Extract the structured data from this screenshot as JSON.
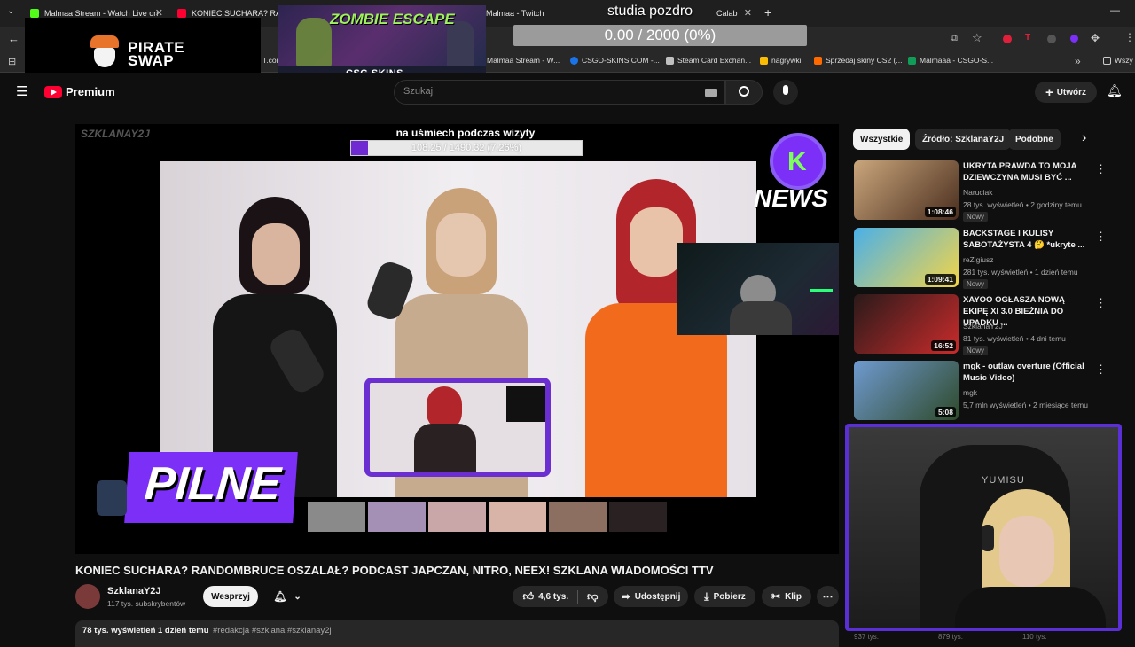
{
  "browser": {
    "tabs": [
      {
        "title": "Malmaa Stream - Watch Live on",
        "color": "#53fc18"
      },
      {
        "title": "KONIEC SUCHARA? RAND",
        "color": "#ff0033"
      },
      {
        "title": "Malmaa - Twitch",
        "color": "#9146ff"
      },
      {
        "title": "Calab",
        "color": "#888888"
      }
    ],
    "new_tab": "+",
    "minimize": "—",
    "bookmarks": [
      {
        "label": "T.com",
        "color": "#4285f4"
      },
      {
        "label": "Malmaa Stream - W...",
        "color": "#53fc18"
      },
      {
        "label": "CSGO-SKINS.COM -...",
        "color": "#1a73e8"
      },
      {
        "label": "Steam Card Exchan...",
        "color": "#c0c0c0"
      },
      {
        "label": "nagrywki",
        "color": "#fbbc04"
      },
      {
        "label": "Sprzedaj skiny CS2 (...",
        "color": "#ff6a00"
      },
      {
        "label": "Malmaaa - CSGO-S...",
        "color": "#0f9d58"
      },
      {
        "label": "Wszy",
        "color": "#888888"
      }
    ],
    "more_bookmarks": "»"
  },
  "overlays": {
    "pirate_logo_line1": "PIRATE",
    "pirate_logo_line2": "SWAP",
    "zombie_title": "ZOMBIE ESCAPE",
    "csgo_skins": "CSG SKINS",
    "studia_text": "studia pozdro",
    "goal_text": "0.00 / 2000 (0%)",
    "video_goal_title": "na uśmiech podczas wizyty",
    "video_goal_text": "108.25 / 1490.32 (7.26%)",
    "video_goal_progress": 0.0726,
    "video_watermark": "SZKLANAY2J",
    "news_label": "NEWS",
    "pilne_label": "PILNE",
    "chair_brand": "YUMISU"
  },
  "youtube": {
    "logo_text": "Premium",
    "search_placeholder": "Szukaj",
    "create_label": "Utwórz",
    "chips": [
      "Wszystkie",
      "Źródło: SzklanaY2J",
      "Podobne"
    ],
    "video_title": "KONIEC SUCHARA? RANDOMBRUCE OSZALAŁ? PODCAST JAPCZAN, NITRO, NEEX! SZKLANA WIADOMOŚCI TTV",
    "channel_name": "SzklanaY2J",
    "subscribers": "117 tys. subskrybentów",
    "support_label": "Wesprzyj",
    "likes": "4,6 tys.",
    "share_label": "Udostępnij",
    "download_label": "Pobierz",
    "clip_label": "Klip",
    "description": {
      "views": "78 tys. wyświetleń",
      "age": "1 dzień temu",
      "tags": "#redakcja #szklana #szklanay2j"
    },
    "recommendations": [
      {
        "title": "UKRYTA PRAWDA TO MOJA DZIEWCZYNA MUSI BYĆ ...",
        "channel": "Naruciak",
        "meta": "28 tys. wyświetleń • 2 godziny temu",
        "badge": "Nowy",
        "duration": "1:08:46",
        "thumb_color": "#b98a5a"
      },
      {
        "title": "BACKSTAGE I KULISY SABOTAŻYSTA 4 🤔 *ukryte ...",
        "channel": "reZigiusz",
        "meta": "281 tys. wyświetleń • 1 dzień temu",
        "badge": "Nowy",
        "duration": "1:09:41",
        "thumb_color": "#3a9bd9"
      },
      {
        "title": "XAYOO OGŁASZA NOWĄ EKIPĘ XI 3.0  BIEŻNIA DO UPADKU ...",
        "channel": "SzklanaY2J",
        "meta": "81 tys. wyświetleń • 4 dni temu",
        "badge": "Nowy",
        "duration": "16:52",
        "thumb_color": "#7a1f24"
      },
      {
        "title": "mgk - outlaw overture (Official Music Video)",
        "channel": "mgk",
        "meta": "5,7 mln wyświetleń • 2 miesiące temu",
        "badge": "",
        "duration": "5:08",
        "thumb_color": "#5b7a9a"
      }
    ],
    "bottom_counts": [
      "937 tys.",
      "879 tys.",
      "110 tys."
    ]
  }
}
